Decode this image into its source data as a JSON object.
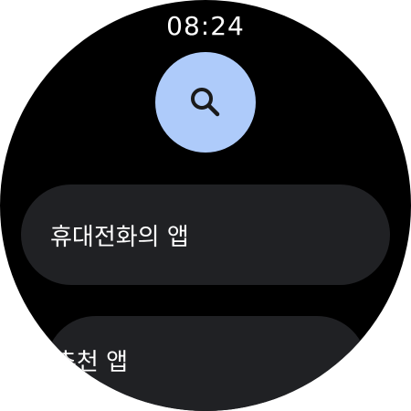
{
  "status": {
    "time": "08:24"
  },
  "search": {
    "icon": "search-icon",
    "bg_color": "#aecbfa"
  },
  "menu": {
    "items": [
      {
        "label": "휴대전화의 앱"
      },
      {
        "label": "추천 앱"
      }
    ],
    "chip_color": "#202124"
  }
}
